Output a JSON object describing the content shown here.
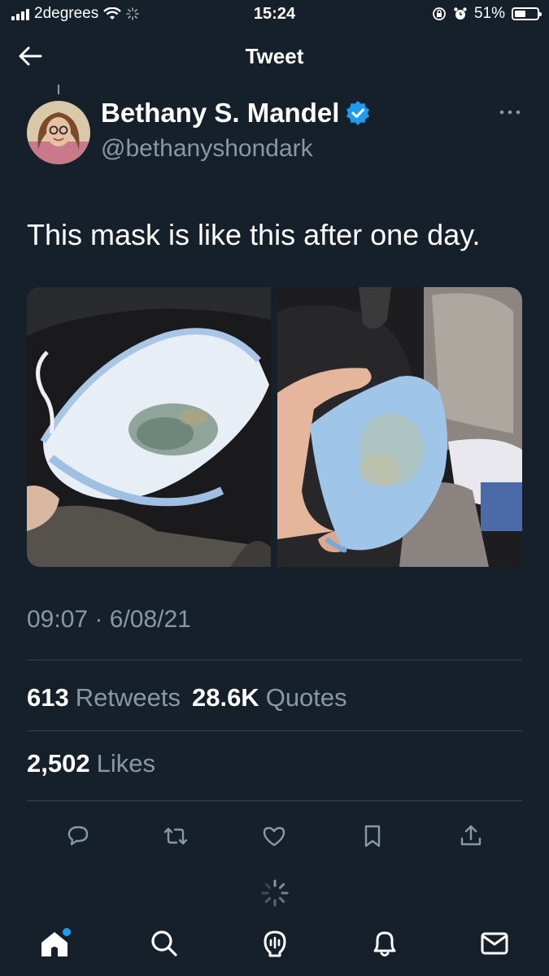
{
  "status_bar": {
    "carrier": "2degrees",
    "time": "15:24",
    "battery": "51%",
    "battery_level": 0.51
  },
  "header": {
    "title": "Tweet"
  },
  "tweet": {
    "author_name": "Bethany S. Mandel",
    "author_handle": "@bethanyshondark",
    "verified": true,
    "text": "This mask is like this after one day.",
    "time": "09:07",
    "separator": "·",
    "date": "6/08/21",
    "images": [
      {
        "name": "mask-photo-left"
      },
      {
        "name": "mask-photo-right"
      }
    ]
  },
  "stats": {
    "retweets_count": "613",
    "retweets_label": "Retweets",
    "quotes_count": "28.6K",
    "quotes_label": "Quotes",
    "likes_count": "2,502",
    "likes_label": "Likes"
  },
  "actions": [
    "reply-icon",
    "retweet-icon",
    "like-icon",
    "bookmark-icon",
    "share-icon"
  ],
  "tabs": [
    "home-icon",
    "search-icon",
    "spaces-icon",
    "notifications-icon",
    "messages-icon"
  ],
  "colors": {
    "background": "#15202b",
    "secondary_text": "#8899a6",
    "divider": "#38444d",
    "verified": "#1d9bf0",
    "notification_dot": "#1d9bf0"
  }
}
